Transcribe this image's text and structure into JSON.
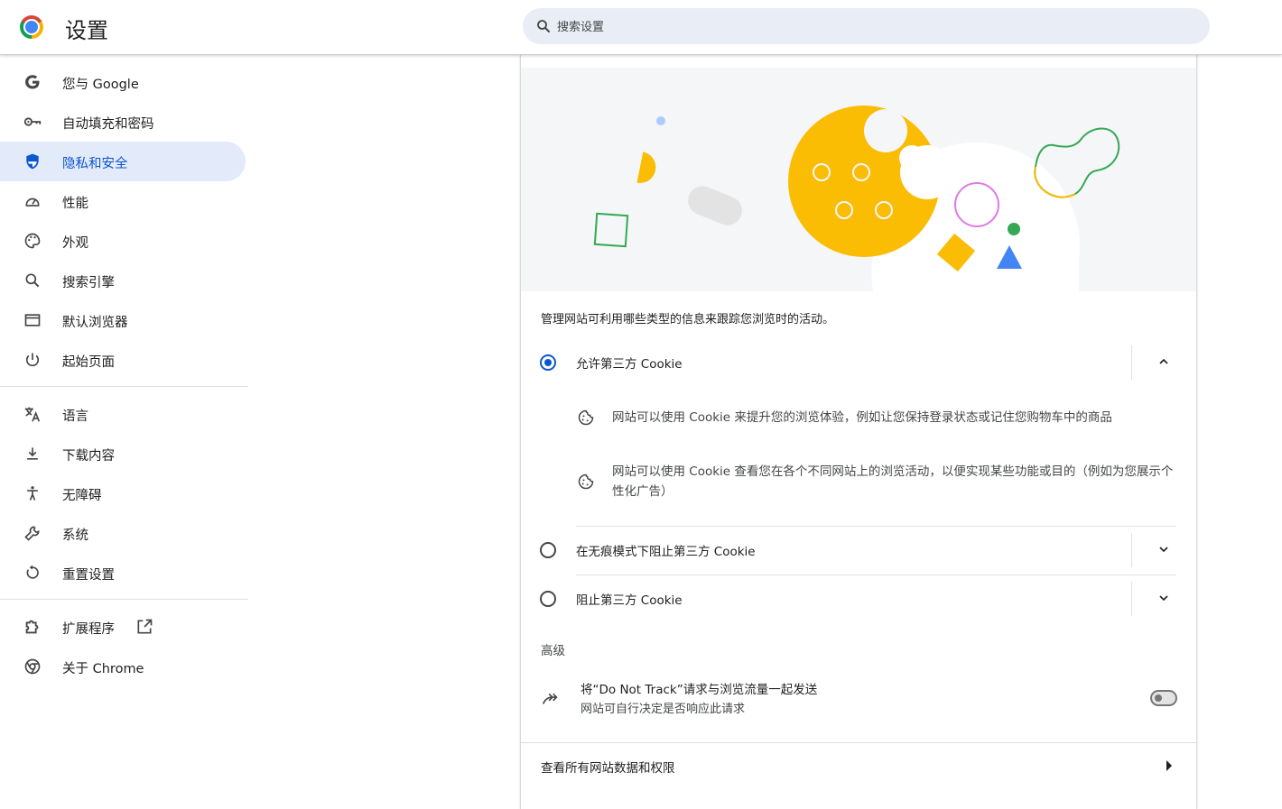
{
  "header": {
    "title": "设置",
    "search_placeholder": "搜索设置"
  },
  "sidebar": {
    "items": [
      {
        "label": "您与 Google",
        "icon": "google-g-icon"
      },
      {
        "label": "自动填充和密码",
        "icon": "key-icon"
      },
      {
        "label": "隐私和安全",
        "icon": "shield-icon",
        "active": true
      },
      {
        "label": "性能",
        "icon": "speedometer-icon"
      },
      {
        "label": "外观",
        "icon": "palette-icon"
      },
      {
        "label": "搜索引擎",
        "icon": "search-icon"
      },
      {
        "label": "默认浏览器",
        "icon": "browser-window-icon"
      },
      {
        "label": "起始页面",
        "icon": "power-icon"
      },
      {
        "label": "语言",
        "icon": "translate-icon"
      },
      {
        "label": "下载内容",
        "icon": "download-icon"
      },
      {
        "label": "无障碍",
        "icon": "accessibility-icon"
      },
      {
        "label": "系统",
        "icon": "wrench-icon"
      },
      {
        "label": "重置设置",
        "icon": "reset-icon"
      },
      {
        "label": "扩展程序",
        "icon": "puzzle-icon"
      },
      {
        "label": "关于 Chrome",
        "icon": "chrome-icon"
      }
    ]
  },
  "main": {
    "description": "管理网站可利用哪些类型的信息来跟踪您浏览时的活动。",
    "options": [
      {
        "label": "允许第三方 Cookie",
        "selected": true,
        "expanded": true
      },
      {
        "label": "在无痕模式下阻止第三方 Cookie",
        "selected": false,
        "expanded": false
      },
      {
        "label": "阻止第三方 Cookie",
        "selected": false,
        "expanded": false
      }
    ],
    "bullets": [
      "网站可以使用 Cookie 来提升您的浏览体验，例如让您保持登录状态或记住您购物车中的商品",
      "网站可以使用 Cookie 查看您在各个不同网站上的浏览活动，以便实现某些功能或目的（例如为您展示个性化广告）"
    ],
    "advanced_title": "高级",
    "dnt": {
      "title": "将“Do Not Track”请求与浏览流量一起发送",
      "subtitle": "网站可自行决定是否响应此请求",
      "enabled": false
    },
    "footer_link": "查看所有网站数据和权限"
  },
  "colors": {
    "accent": "#0b57d0",
    "active_bg": "#e3eafa",
    "cookie_yellow": "#fbbc04",
    "green": "#34a853",
    "blue": "#4285f4"
  }
}
